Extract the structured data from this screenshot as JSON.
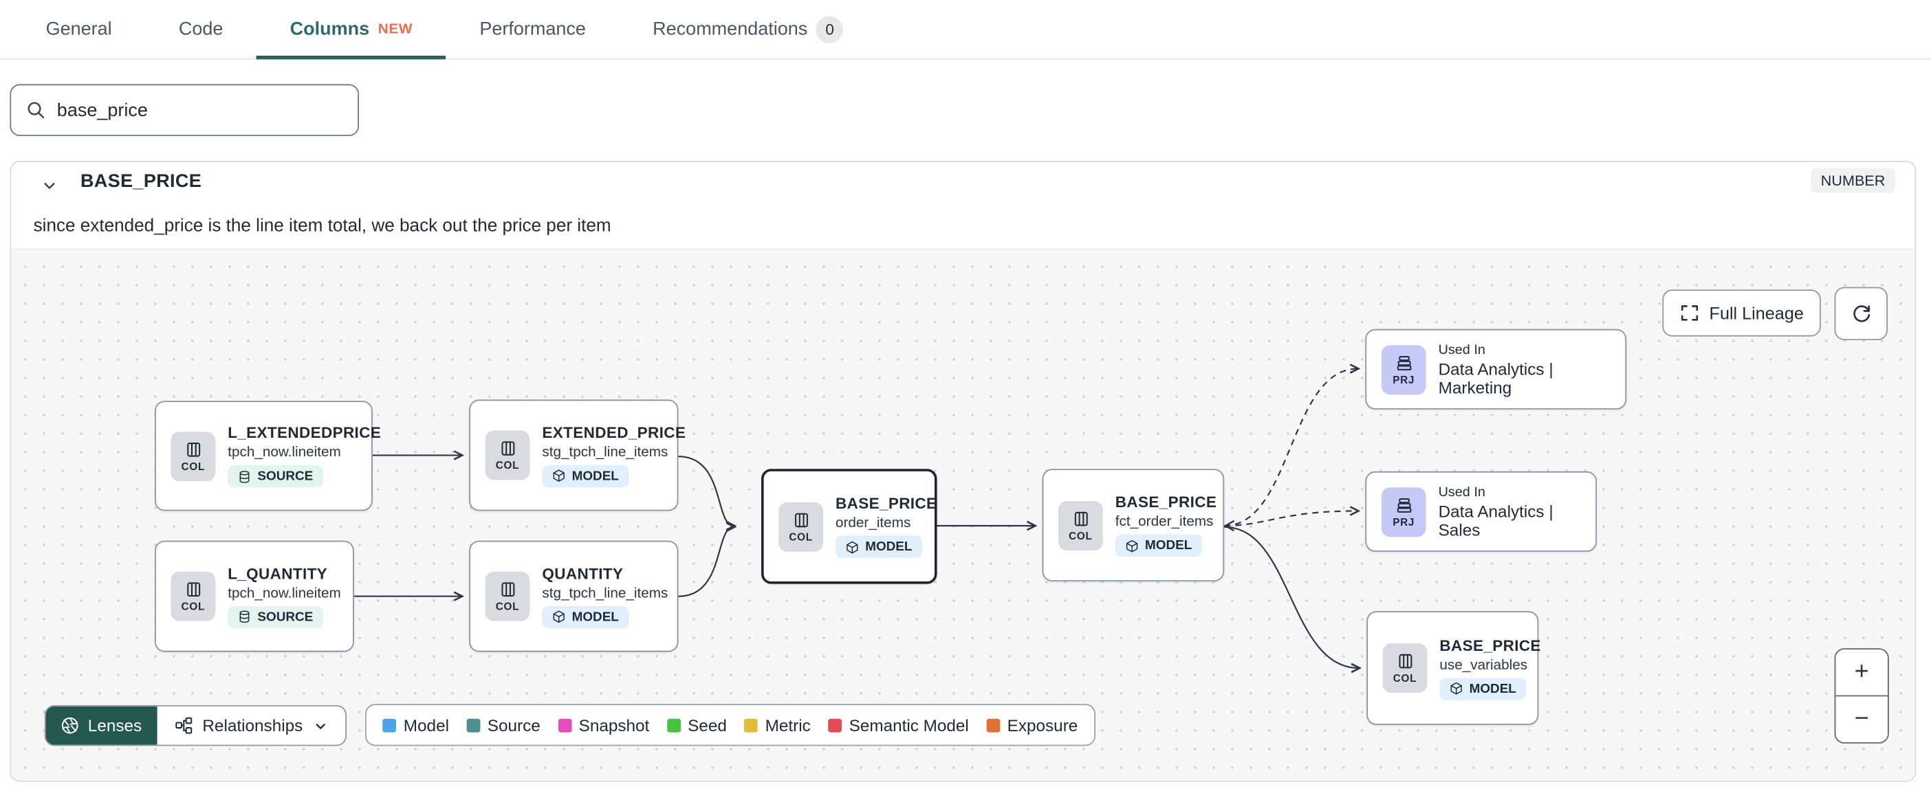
{
  "tabs": {
    "items": [
      {
        "label": "General"
      },
      {
        "label": "Code"
      },
      {
        "label": "Columns",
        "badge": "NEW",
        "active": true
      },
      {
        "label": "Performance"
      },
      {
        "label": "Recommendations",
        "count": "0"
      }
    ]
  },
  "search": {
    "value": "base_price"
  },
  "column_panel": {
    "title": "BASE_PRICE",
    "type_badge": "NUMBER",
    "description": "since extended_price is the line item total, we back out the price per item"
  },
  "lineage": {
    "controls": {
      "full_lineage_label": "Full Lineage",
      "lenses_label": "Lenses",
      "relationships_label": "Relationships",
      "zoom_in": "+",
      "zoom_out": "−"
    },
    "legend": [
      {
        "label": "Model",
        "color": "#4da3ea"
      },
      {
        "label": "Source",
        "color": "#4f908c"
      },
      {
        "label": "Snapshot",
        "color": "#e14ec0"
      },
      {
        "label": "Seed",
        "color": "#48c33f"
      },
      {
        "label": "Metric",
        "color": "#e0bd3a"
      },
      {
        "label": "Semantic Model",
        "color": "#e44b59"
      },
      {
        "label": "Exposure",
        "color": "#df7136"
      }
    ],
    "nodes": [
      {
        "chip": "COL",
        "title": "L_EXTENDEDPRICE",
        "subtitle": "tpch_now.lineitem",
        "badge": "SOURCE"
      },
      {
        "chip": "COL",
        "title": "L_QUANTITY",
        "subtitle": "tpch_now.lineitem",
        "badge": "SOURCE"
      },
      {
        "chip": "COL",
        "title": "EXTENDED_PRICE",
        "subtitle": "stg_tpch_line_items",
        "badge": "MODEL"
      },
      {
        "chip": "COL",
        "title": "QUANTITY",
        "subtitle": "stg_tpch_line_items",
        "badge": "MODEL"
      },
      {
        "chip": "COL",
        "title": "BASE_PRICE",
        "subtitle": "order_items",
        "badge": "MODEL"
      },
      {
        "chip": "COL",
        "title": "BASE_PRICE",
        "subtitle": "fct_order_items",
        "badge": "MODEL"
      },
      {
        "chip": "PRJ",
        "eyebrow": "Used In",
        "title": "Data Analytics | Marketing"
      },
      {
        "chip": "PRJ",
        "eyebrow": "Used In",
        "title": "Data Analytics | Sales"
      },
      {
        "chip": "COL",
        "title": "BASE_PRICE",
        "subtitle": "use_variables",
        "badge": "MODEL"
      }
    ],
    "colors": {
      "active_tab": "#2e6a6a",
      "new_badge": "#ee6a4d",
      "lenses_green": "#24584e",
      "source_badge_bg": "#e3f3ed",
      "model_badge_bg": "#e0effb",
      "prj_chip_bg": "#c6c9f8",
      "col_chip_bg": "#d9dbe0"
    }
  }
}
